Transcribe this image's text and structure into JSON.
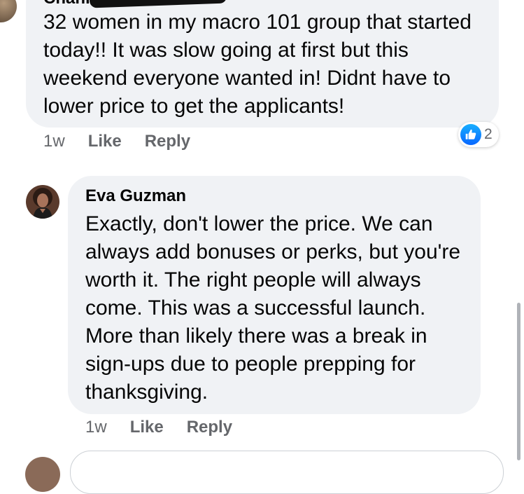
{
  "comments": [
    {
      "author": "Channe",
      "text": "32 women in my macro 101 group that started today!! It was slow going at first but this weekend everyone wanted in! Didnt have to lower price to get the applicants!",
      "time": "1w",
      "like_label": "Like",
      "reply_label": "Reply",
      "reaction_count": "2",
      "reaction_icon": "like-icon"
    },
    {
      "author": "Eva Guzman",
      "text": "Exactly, don't lower the price. We can always add bonuses or perks, but you're worth it. The right people will always come. This was a successful launch. More than likely there was a break in sign-ups due to people prepping for thanksgiving.",
      "time": "1w",
      "like_label": "Like",
      "reply_label": "Reply"
    }
  ],
  "colors": {
    "bubble": "#f0f2f5",
    "meta_text": "#65676b",
    "like_blue": "#0866ff"
  }
}
